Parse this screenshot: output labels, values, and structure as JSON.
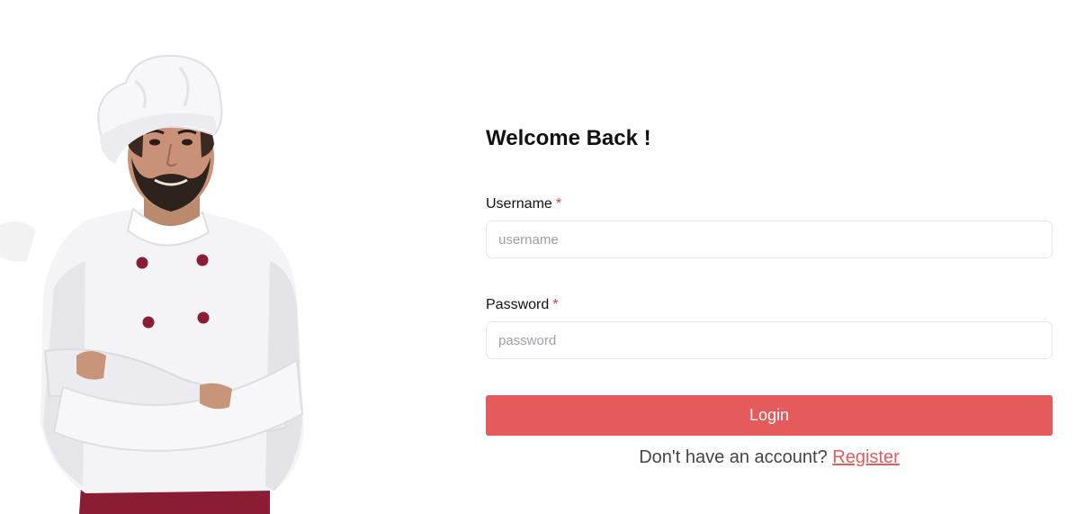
{
  "hero": {
    "image": "chef-illustration"
  },
  "form": {
    "title": "Welcome Back !",
    "username": {
      "label": "Username",
      "required_mark": "*",
      "placeholder": "username",
      "value": ""
    },
    "password": {
      "label": "Password",
      "required_mark": "*",
      "placeholder": "password",
      "value": ""
    },
    "login_label": "Login",
    "register_prompt": "Don't have an account?",
    "register_link": "Register"
  },
  "colors": {
    "accent": "#e55a5a",
    "required": "#e33535",
    "input_border": "#e3e5ea",
    "text": "#111111"
  }
}
